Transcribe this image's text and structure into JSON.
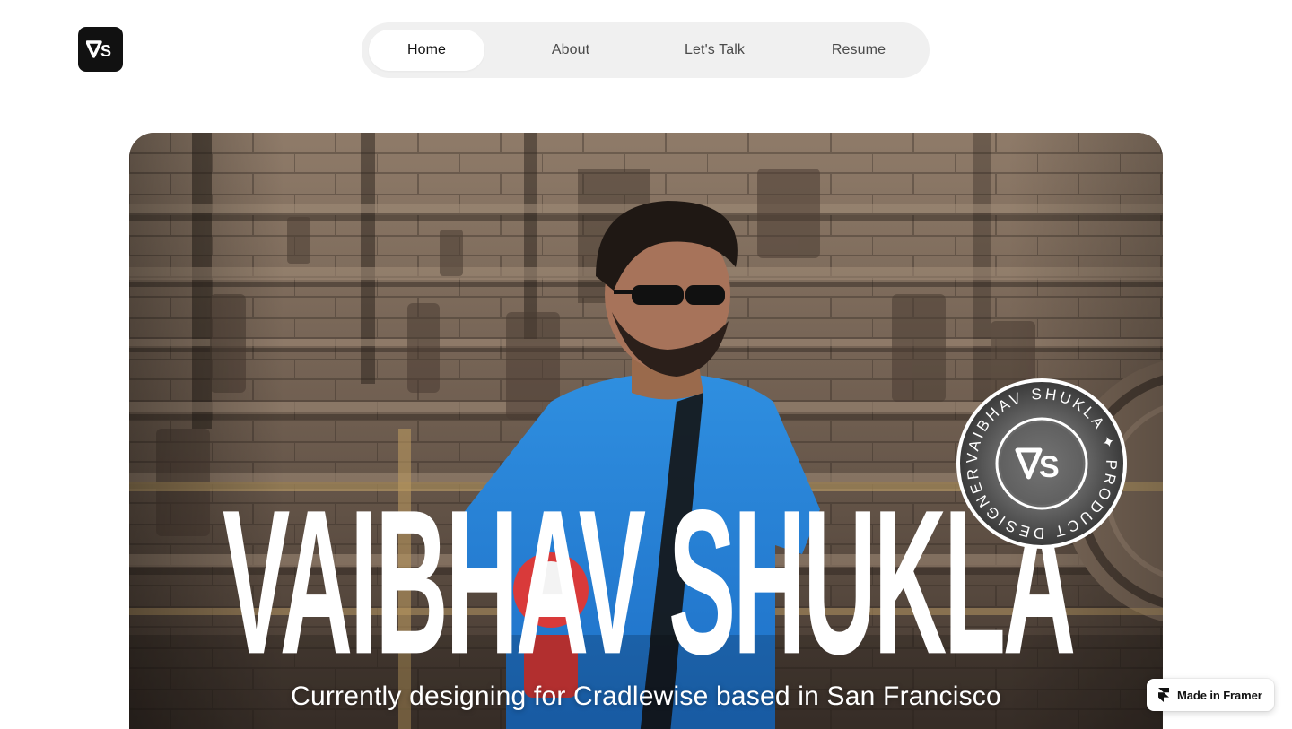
{
  "header": {
    "logo": {
      "text": "VS",
      "icon": "vs-monogram-icon"
    },
    "nav": [
      {
        "label": "Home",
        "active": true
      },
      {
        "label": "About",
        "active": false
      },
      {
        "label": "Let's Talk",
        "active": false
      },
      {
        "label": "Resume",
        "active": false
      }
    ]
  },
  "hero": {
    "name": "VAIBHAV SHUKLA",
    "tagline": "Currently designing for Cradlewise based in San Francisco",
    "photo": "portrait-at-stone-temple-photo",
    "stamp": {
      "ring_text": "VAIBHAV SHUKLA ✦ PRODUCT DESIGNER ✦",
      "monogram": "VS"
    }
  },
  "badge": {
    "label": "Made in Framer",
    "icon": "framer-icon"
  },
  "colors": {
    "nav_bg": "#f0f0f0",
    "nav_active_bg": "#ffffff",
    "logo_bg": "#111111",
    "text_white": "#ffffff"
  }
}
